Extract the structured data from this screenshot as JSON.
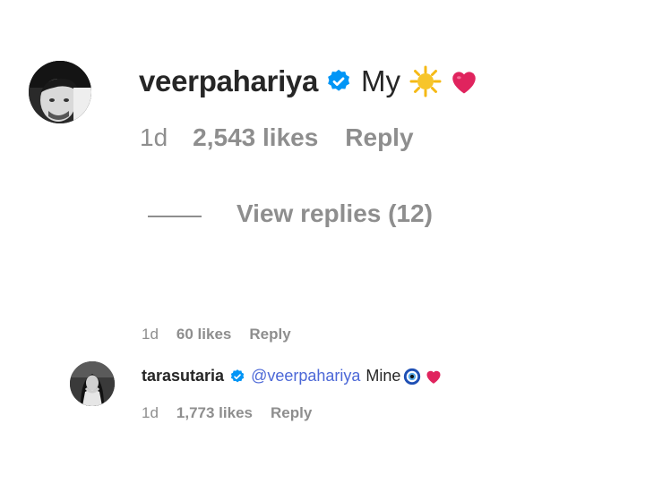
{
  "comment_main": {
    "username": "veerpahariya",
    "verified_icon": "verified-badge-icon",
    "text": "My",
    "emojis": [
      "sun-emoji-icon",
      "heart-emoji-icon"
    ],
    "time": "1d",
    "likes": "2,543 likes",
    "reply_label": "Reply",
    "view_replies": "View replies (12)"
  },
  "reply_row_above": {
    "time": "1d",
    "likes": "60 likes",
    "reply_label": "Reply"
  },
  "comment_second": {
    "username": "tarasutaria",
    "verified_icon": "verified-badge-icon",
    "mention": "@veerpahariya",
    "text": "Mine",
    "emojis": [
      "nazar-amulet-icon",
      "heart-emoji-icon"
    ],
    "time": "1d",
    "likes": "1,773 likes",
    "reply_label": "Reply"
  },
  "colors": {
    "text_primary": "#262626",
    "text_secondary": "#8e8e8e",
    "verified_blue": "#0095f6",
    "mention_blue": "#4c68d7",
    "heart_red": "#e0245e"
  }
}
